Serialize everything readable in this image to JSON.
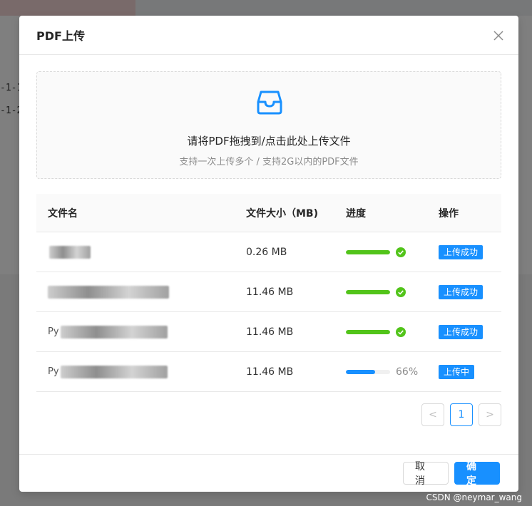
{
  "background": {
    "row1": "-1-1",
    "row2": "-1-2"
  },
  "modal": {
    "title": "PDF上传",
    "close_icon": "close-icon"
  },
  "dropzone": {
    "icon": "inbox-icon",
    "text": "请将PDF拖拽到/点击此处上传文件",
    "hint": "支持一次上传多个 / 支持2G以内的PDF文件"
  },
  "table": {
    "headers": [
      "文件名",
      "文件大小（MB)",
      "进度",
      "操作"
    ],
    "rows": [
      {
        "name": "",
        "size": "0.26 MB",
        "progress": 100,
        "percent_label": "",
        "status": "上传成功"
      },
      {
        "name": "",
        "size": "11.46 MB",
        "progress": 100,
        "percent_label": "",
        "status": "上传成功"
      },
      {
        "name": "Py",
        "size": "11.46 MB",
        "progress": 100,
        "percent_label": "",
        "status": "上传成功"
      },
      {
        "name": "Py",
        "size": "11.46 MB",
        "progress": 66,
        "percent_label": "66%",
        "status": "上传中"
      }
    ]
  },
  "pagination": {
    "prev": "<",
    "current": "1",
    "next": ">"
  },
  "footer": {
    "cancel": "取消",
    "ok": "确定"
  },
  "watermark": "CSDN @neymar_wang",
  "colors": {
    "primary": "#1890ff",
    "success": "#52c41a"
  }
}
